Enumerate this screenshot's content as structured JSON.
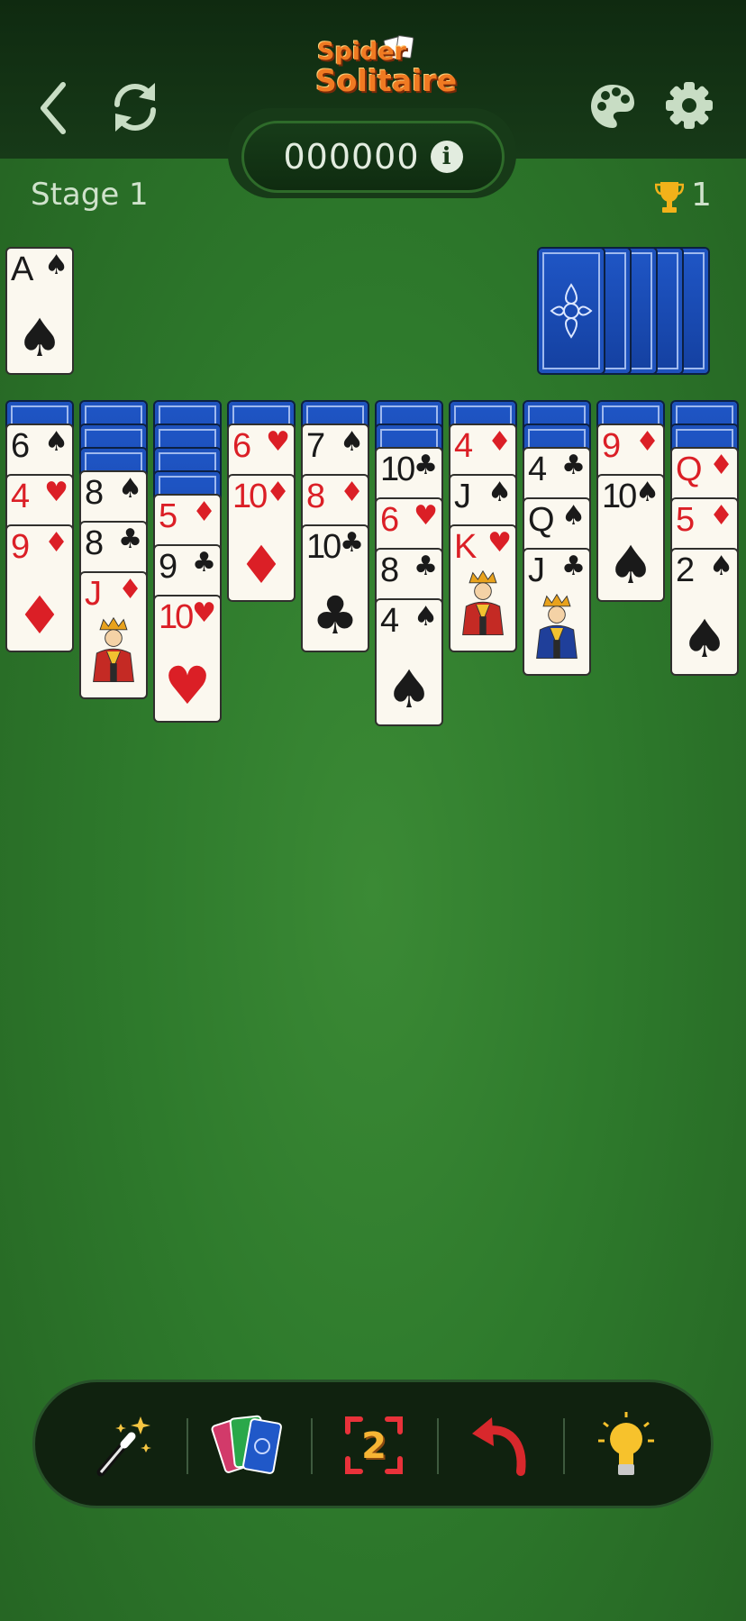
{
  "header": {
    "logo_line1": "Spider",
    "logo_line2": "Solitaire",
    "score": "000000",
    "stage_label": "Stage 1",
    "trophies": "1"
  },
  "icons": {
    "back": "chevron-left-icon",
    "restart": "refresh-icon",
    "theme": "palette-icon",
    "settings": "gear-icon",
    "info": "info-icon",
    "trophy": "trophy-icon"
  },
  "foundation": [
    {
      "rank": "A",
      "suit": "♠",
      "color": "black"
    }
  ],
  "stock_piles_remaining": 5,
  "tableau": [
    {
      "hidden": 1,
      "cards": [
        {
          "rank": "6",
          "suit": "♠",
          "color": "black"
        },
        {
          "rank": "4",
          "suit": "♥",
          "color": "red"
        },
        {
          "rank": "9",
          "suit": "♦",
          "color": "red"
        }
      ]
    },
    {
      "hidden": 3,
      "cards": [
        {
          "rank": "8",
          "suit": "♠",
          "color": "black"
        },
        {
          "rank": "8",
          "suit": "♣",
          "color": "black"
        },
        {
          "rank": "J",
          "suit": "♦",
          "color": "red",
          "face": true
        }
      ]
    },
    {
      "hidden": 4,
      "cards": [
        {
          "rank": "5",
          "suit": "♦",
          "color": "red"
        },
        {
          "rank": "9",
          "suit": "♣",
          "color": "black"
        },
        {
          "rank": "10",
          "suit": "♥",
          "color": "red"
        }
      ]
    },
    {
      "hidden": 1,
      "cards": [
        {
          "rank": "6",
          "suit": "♥",
          "color": "red"
        },
        {
          "rank": "10",
          "suit": "♦",
          "color": "red"
        }
      ]
    },
    {
      "hidden": 1,
      "cards": [
        {
          "rank": "7",
          "suit": "♠",
          "color": "black"
        },
        {
          "rank": "8",
          "suit": "♦",
          "color": "red"
        },
        {
          "rank": "10",
          "suit": "♣",
          "color": "black"
        }
      ]
    },
    {
      "hidden": 2,
      "cards": [
        {
          "rank": "10",
          "suit": "♣",
          "color": "black"
        },
        {
          "rank": "6",
          "suit": "♥",
          "color": "red"
        },
        {
          "rank": "8",
          "suit": "♣",
          "color": "black"
        },
        {
          "rank": "4",
          "suit": "♠",
          "color": "black"
        }
      ]
    },
    {
      "hidden": 1,
      "cards": [
        {
          "rank": "4",
          "suit": "♦",
          "color": "red"
        },
        {
          "rank": "J",
          "suit": "♠",
          "color": "black"
        },
        {
          "rank": "K",
          "suit": "♥",
          "color": "red",
          "face": true
        }
      ]
    },
    {
      "hidden": 2,
      "cards": [
        {
          "rank": "4",
          "suit": "♣",
          "color": "black"
        },
        {
          "rank": "Q",
          "suit": "♠",
          "color": "black"
        },
        {
          "rank": "J",
          "suit": "♣",
          "color": "black",
          "face": true
        }
      ]
    },
    {
      "hidden": 1,
      "cards": [
        {
          "rank": "9",
          "suit": "♦",
          "color": "red"
        },
        {
          "rank": "10",
          "suit": "♠",
          "color": "black"
        }
      ]
    },
    {
      "hidden": 2,
      "cards": [
        {
          "rank": "Q",
          "suit": "♦",
          "color": "red"
        },
        {
          "rank": "5",
          "suit": "♦",
          "color": "red"
        },
        {
          "rank": "2",
          "suit": "♠",
          "color": "black"
        }
      ]
    }
  ],
  "toolbar": {
    "tools": [
      {
        "name": "magic-wand-icon"
      },
      {
        "name": "deal-cards-icon"
      },
      {
        "name": "suit-count-icon",
        "label": "2"
      },
      {
        "name": "undo-icon"
      },
      {
        "name": "hint-bulb-icon"
      }
    ]
  },
  "colors": {
    "felt": "#2e7a2c",
    "topbar": "#12301a",
    "card_back": "#1a4cb8",
    "red_suit": "#db1f26"
  }
}
